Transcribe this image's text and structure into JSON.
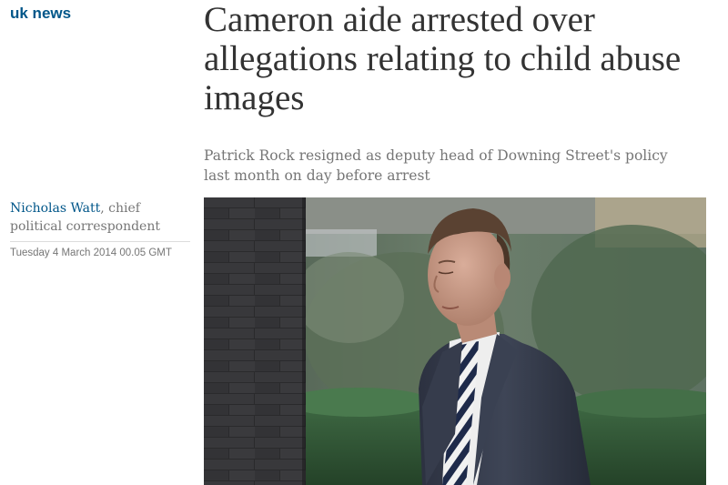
{
  "section": {
    "label": "uk news",
    "color": "#005689"
  },
  "article": {
    "headline": "Cameron aide arrested over allegations relating to child abuse images",
    "standfirst": "Patrick Rock resigned as deputy head of Downing Street's policy last month on day before arrest",
    "byline": {
      "author": "Nicholas Watt",
      "role": ", chief political correspondent"
    },
    "dateline": "Tuesday 4 March 2014 00.05 GMT",
    "image": {
      "icon": "photo-man-in-suit-outside-downing-street"
    }
  },
  "colors": {
    "headline": "#333333",
    "secondary_text": "#767676",
    "link": "#005689"
  }
}
